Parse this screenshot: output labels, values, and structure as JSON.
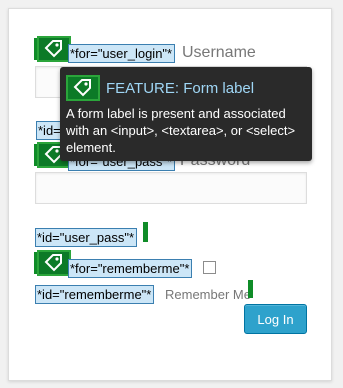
{
  "form": {
    "username_label": "Username",
    "password_label": "Password",
    "remember_label": "Remember Me",
    "login_button": "Log In"
  },
  "annotations": {
    "for_user_login": "*for=\"user_login\"*",
    "id_user_login": "*id=",
    "for_user_pass": "*for=\"user_pass\"*",
    "id_user_pass": "*id=\"user_pass\"*",
    "for_rememberme": "*for=\"rememberme\"*",
    "id_rememberme": "*id=\"rememberme\"*"
  },
  "tooltip": {
    "title": "FEATURE: Form label",
    "body": "A form label is present and associated with an <input>, <textarea>, or <select> element."
  },
  "colors": {
    "accent_button": "#2ea2cc",
    "tag_background": "#cce6f7",
    "marker_green": "#0c7a27",
    "tooltip_background": "#2a2a2a",
    "tooltip_title": "#9fd6f5"
  },
  "icons": {
    "marker": "tag-icon"
  }
}
